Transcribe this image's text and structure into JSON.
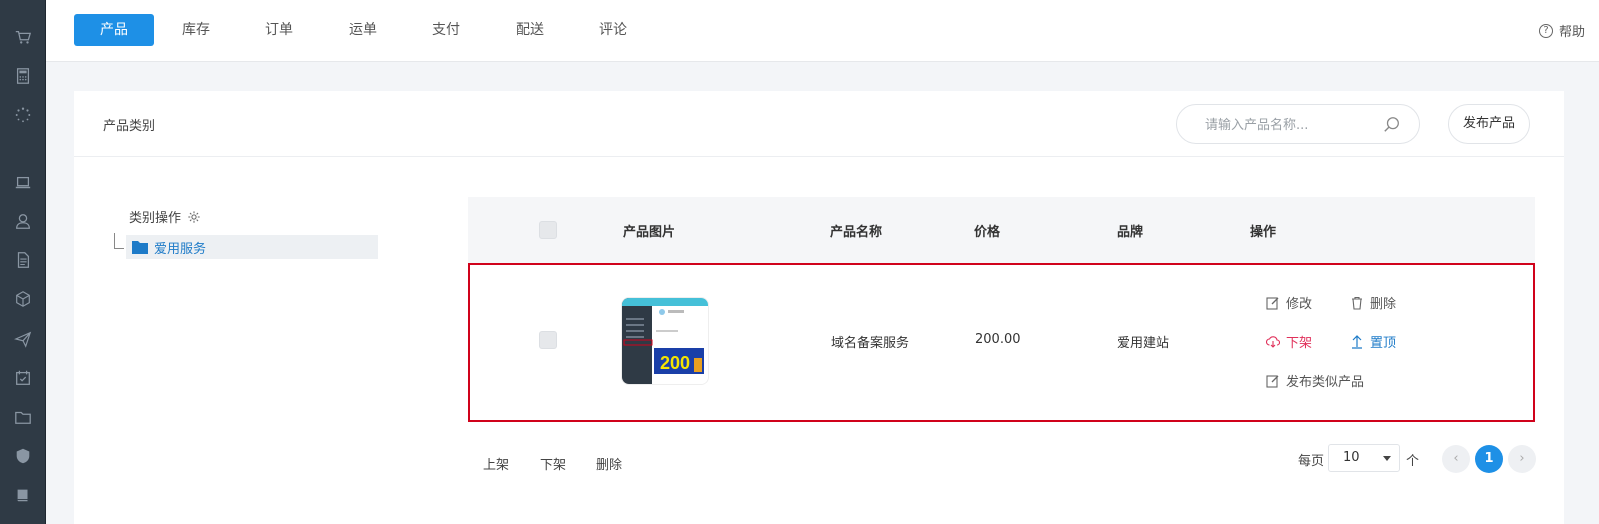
{
  "sidebar": {
    "icons": [
      "cart-icon",
      "calculator-icon",
      "loading-icon",
      "laptop-icon",
      "user-icon",
      "document-icon",
      "cube-icon",
      "send-icon",
      "calendar-check-icon",
      "folder-icon",
      "shield-icon",
      "book-icon"
    ]
  },
  "topnav": {
    "tabs": [
      {
        "label": "产品",
        "active": true
      },
      {
        "label": "库存"
      },
      {
        "label": "订单"
      },
      {
        "label": "运单"
      },
      {
        "label": "支付"
      },
      {
        "label": "配送"
      },
      {
        "label": "评论"
      }
    ],
    "help_label": "帮助",
    "help_icon": "?"
  },
  "panel": {
    "title": "产品类别",
    "search_placeholder": "请输入产品名称...",
    "publish_label": "发布产品"
  },
  "category_tree": {
    "ops_label": "类别操作",
    "nodes": [
      {
        "label": "爱用服务",
        "selected": true
      }
    ]
  },
  "table": {
    "headers": {
      "image": "产品图片",
      "name": "产品名称",
      "price": "价格",
      "brand": "品牌",
      "actions": "操作"
    },
    "rows": [
      {
        "name": "域名备案服务",
        "price": "200.00",
        "brand": "爱用建站",
        "thumb_text": "200",
        "actions": {
          "edit": "修改",
          "delete": "删除",
          "unshelve": "下架",
          "pin": "置顶",
          "publish_similar": "发布类似产品"
        }
      }
    ]
  },
  "bulk_actions": {
    "shelve": "上架",
    "unshelve": "下架",
    "delete": "删除"
  },
  "pagination": {
    "per_page_prefix": "每页",
    "per_page_value": "10",
    "per_page_suffix": "个",
    "prev": "‹",
    "current": "1",
    "next": "›"
  },
  "colors": {
    "accent": "#1e90e6",
    "sidebar": "#2f3a45",
    "highlight_border": "#d0021b",
    "danger": "#e0305a"
  }
}
